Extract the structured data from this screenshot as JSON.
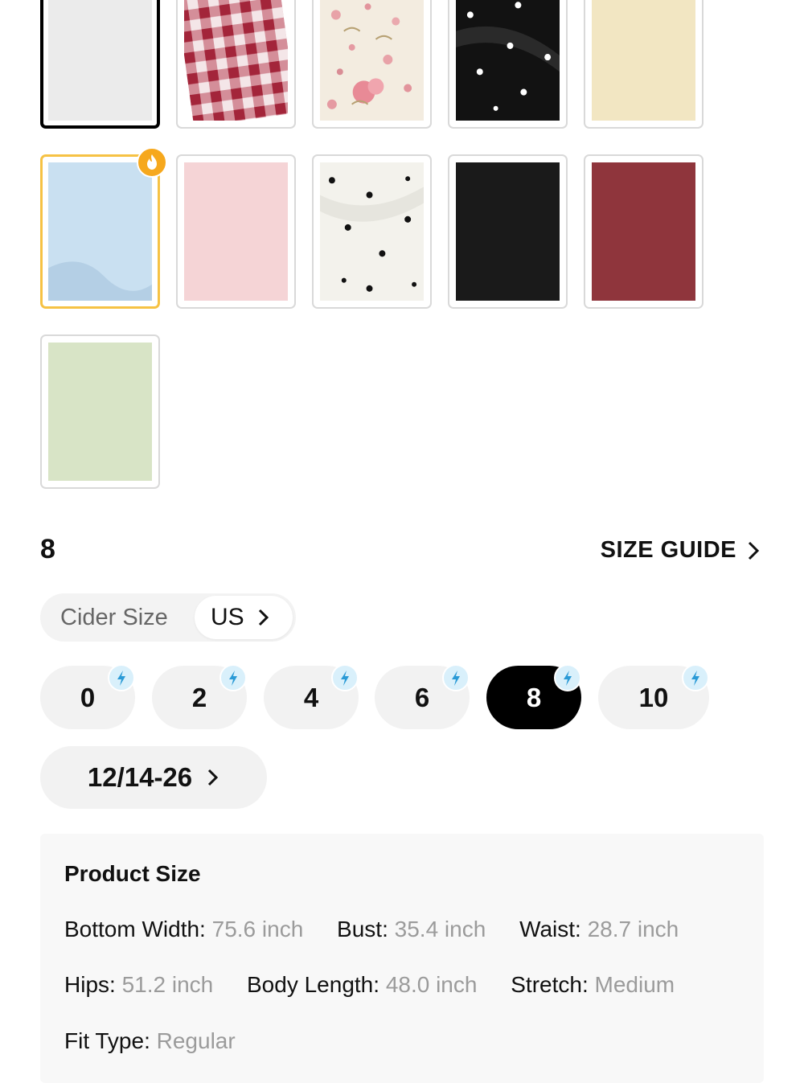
{
  "swatches": [
    {
      "name": "white",
      "row": 1
    },
    {
      "name": "red-gingham",
      "row": 1
    },
    {
      "name": "pink-floral",
      "row": 1
    },
    {
      "name": "black-polka-dot",
      "row": 1
    },
    {
      "name": "cream",
      "row": 1
    },
    {
      "name": "light-blue",
      "row": 2,
      "hot": true
    },
    {
      "name": "pink",
      "row": 2
    },
    {
      "name": "white-polka-dot",
      "row": 2
    },
    {
      "name": "black",
      "row": 2
    },
    {
      "name": "burgundy",
      "row": 2
    },
    {
      "name": "sage-green",
      "row": 3
    }
  ],
  "colors": {
    "white": "#ebebeb",
    "cream": "#f2e6c2",
    "light_blue": "#c7dff0",
    "pink": "#f5d4d6",
    "black": "#1a1a1a",
    "burgundy": "#8f353c",
    "sage_green": "#d8e4c6",
    "hot_badge": "#f6a81d",
    "quick_badge": "#d9f0fb",
    "quick_bolt": "#2a9ad6",
    "selected_border": "#000000",
    "hot_border": "#f6c244"
  },
  "size": {
    "selected_value": "8",
    "guide_label": "SIZE GUIDE",
    "system_label": "Cider Size",
    "system_value": "US",
    "options": [
      "0",
      "2",
      "4",
      "6",
      "8",
      "10"
    ],
    "active": "8",
    "more_label": "12/14-26"
  },
  "product_size": {
    "title": "Product Size",
    "fields": [
      {
        "label": "Bottom Width:",
        "value": "75.6 inch"
      },
      {
        "label": "Bust:",
        "value": "35.4 inch"
      },
      {
        "label": "Waist:",
        "value": "28.7 inch"
      },
      {
        "label": "Hips:",
        "value": "51.2 inch"
      },
      {
        "label": "Body Length:",
        "value": "48.0 inch"
      },
      {
        "label": "Stretch:",
        "value": "Medium"
      },
      {
        "label": "Fit Type:",
        "value": "Regular"
      }
    ]
  }
}
